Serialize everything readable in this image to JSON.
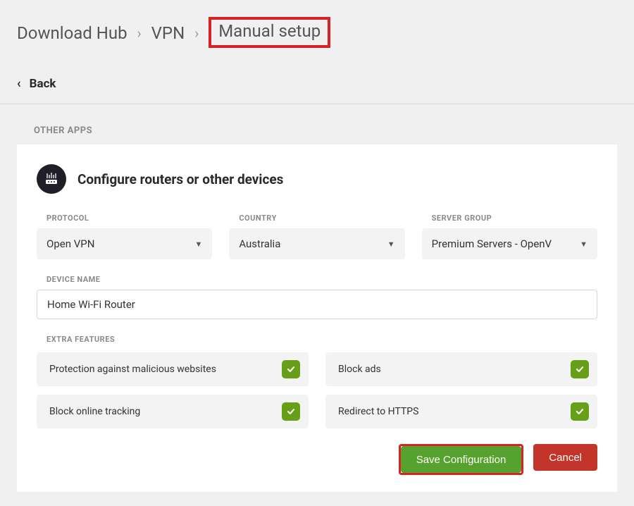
{
  "breadcrumb": {
    "items": [
      "Download Hub",
      "VPN",
      "Manual setup"
    ]
  },
  "back": {
    "label": "Back"
  },
  "section_label": "OTHER APPS",
  "card": {
    "title": "Configure routers or other devices",
    "protocol": {
      "label": "PROTOCOL",
      "value": "Open VPN"
    },
    "country": {
      "label": "COUNTRY",
      "value": "Australia"
    },
    "server_group": {
      "label": "SERVER GROUP",
      "value": "Premium Servers - OpenV"
    },
    "device_name": {
      "label": "DEVICE NAME",
      "value": "Home Wi-Fi Router"
    },
    "extra_features_label": "EXTRA FEATURES",
    "features": [
      {
        "label": "Protection against malicious websites",
        "checked": true
      },
      {
        "label": "Block ads",
        "checked": true
      },
      {
        "label": "Block online tracking",
        "checked": true
      },
      {
        "label": "Redirect to HTTPS",
        "checked": true
      }
    ],
    "save_label": "Save Configuration",
    "cancel_label": "Cancel"
  }
}
